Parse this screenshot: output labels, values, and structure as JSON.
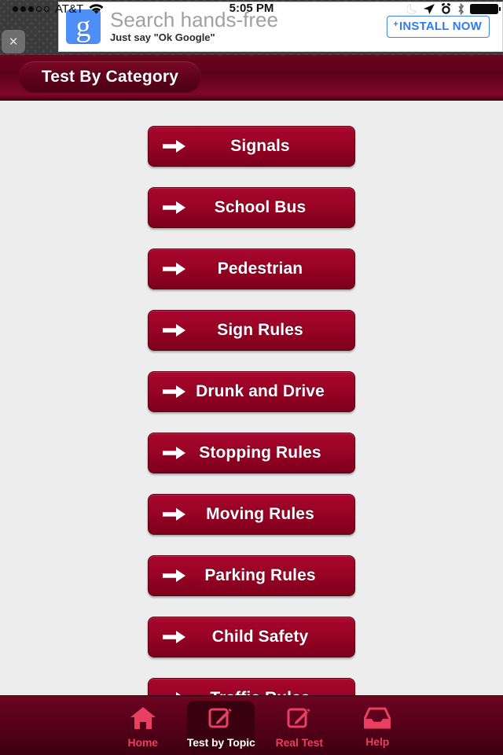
{
  "statusbar": {
    "carrier": "AT&T",
    "signal_dots_filled": 3,
    "signal_dots_empty": 2,
    "wifi_icon": "wifi-icon",
    "time": "5:05 PM",
    "icons": [
      "moon-icon",
      "location-arrow-icon",
      "alarm-clock-icon",
      "bluetooth-icon",
      "battery-icon"
    ]
  },
  "ad": {
    "logo": "google-g-logo",
    "title": "Search hands-free",
    "subtitle": "Just say \"Ok Google\"",
    "install_plus": "+",
    "install_label": "INSTALL NOW",
    "close_label": "×"
  },
  "header": {
    "title": "Test By Category"
  },
  "categories": [
    {
      "label": "Signals"
    },
    {
      "label": "School Bus"
    },
    {
      "label": "Pedestrian"
    },
    {
      "label": "Sign Rules"
    },
    {
      "label": "Drunk and Drive"
    },
    {
      "label": "Stopping Rules"
    },
    {
      "label": "Moving Rules"
    },
    {
      "label": "Parking Rules"
    },
    {
      "label": "Child Safety"
    },
    {
      "label": "Traffic Rules"
    }
  ],
  "tabbar": {
    "tabs": [
      {
        "label": "Home",
        "icon": "home-icon",
        "selected": false
      },
      {
        "label": "Test by Topic",
        "icon": "edit-note-icon",
        "selected": true
      },
      {
        "label": "Real Test",
        "icon": "edit-note-icon",
        "selected": false
      },
      {
        "label": "Help",
        "icon": "inbox-tray-icon",
        "selected": false
      }
    ]
  },
  "colors": {
    "brand_dark": "#5d0019",
    "brand_button": "#9c0427",
    "accent_pink": "#e83f62",
    "content_bg": "#ededed",
    "ad_blue": "#2f7bed"
  }
}
